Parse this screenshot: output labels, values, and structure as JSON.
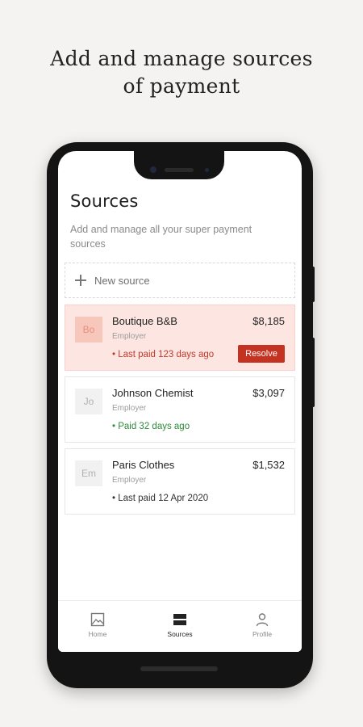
{
  "headline": {
    "line1": "Add and manage sources",
    "line2": "of payment"
  },
  "screen": {
    "title": "Sources",
    "subtitle": "Add and manage all your super payment sources",
    "new_source_label": "New source",
    "sources": [
      {
        "initials": "Bo",
        "name": "Boutique B&B",
        "role": "Employer",
        "amount": "$8,185",
        "status": "• Last paid 123 days ago",
        "status_tone": "alert",
        "action": "Resolve"
      },
      {
        "initials": "Jo",
        "name": "Johnson Chemist",
        "role": "Employer",
        "amount": "$3,097",
        "status": "• Paid 32 days ago",
        "status_tone": "good"
      },
      {
        "initials": "Em",
        "name": "Paris Clothes",
        "role": "Employer",
        "amount": "$1,532",
        "status": "• Last paid 12 Apr 2020",
        "status_tone": "neutral"
      }
    ]
  },
  "nav": {
    "items": [
      {
        "label": "Home",
        "icon": "image-icon"
      },
      {
        "label": "Sources",
        "icon": "stack-icon",
        "active": true
      },
      {
        "label": "Profile",
        "icon": "person-icon"
      }
    ]
  },
  "colors": {
    "alert_bg": "#fde6e2",
    "resolve_button": "#c43322",
    "good_text": "#2e8b3a",
    "alert_text": "#c0392b"
  }
}
